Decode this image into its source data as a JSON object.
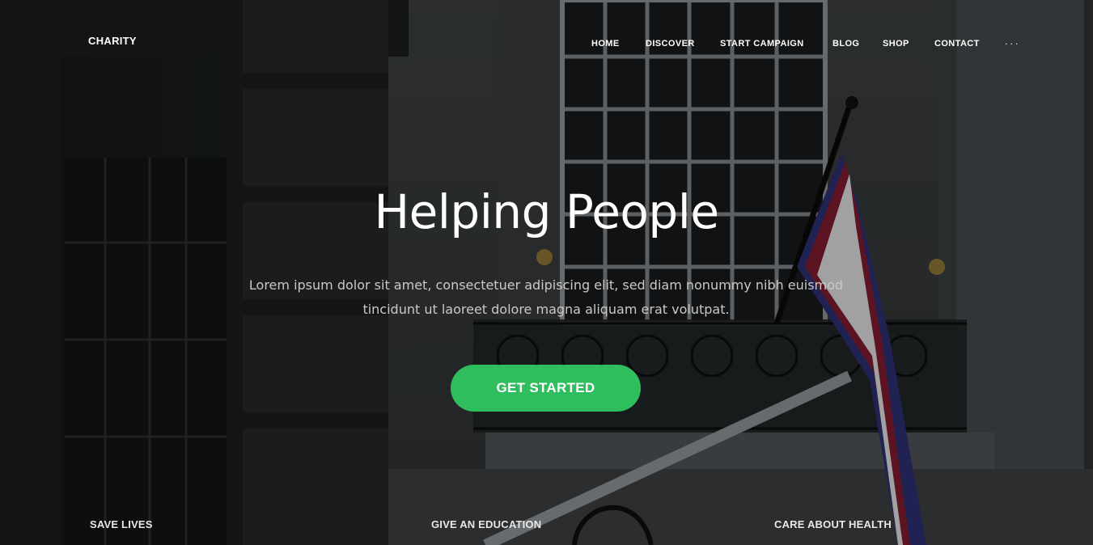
{
  "header": {
    "brand": "CHARITY",
    "nav": [
      {
        "label": "HOME"
      },
      {
        "label": "DISCOVER"
      },
      {
        "label": "START CAMPAIGN"
      },
      {
        "label": "BLOG"
      },
      {
        "label": "SHOP"
      },
      {
        "label": "CONTACT"
      }
    ],
    "more_label": "···"
  },
  "hero": {
    "title": "Helping People",
    "text": "Lorem ipsum dolor sit amet, consectetuer adipiscing elit, sed diam nonummy nibh euismod tincidunt ut laoreet dolore magna aliquam erat volutpat.",
    "cta_label": "GET STARTED",
    "accent_color": "#2fbe5e"
  },
  "features": [
    {
      "label": "SAVE LIVES"
    },
    {
      "label": "GIVE AN EDUCATION"
    },
    {
      "label": "CARE ABOUT HEALTH"
    }
  ]
}
